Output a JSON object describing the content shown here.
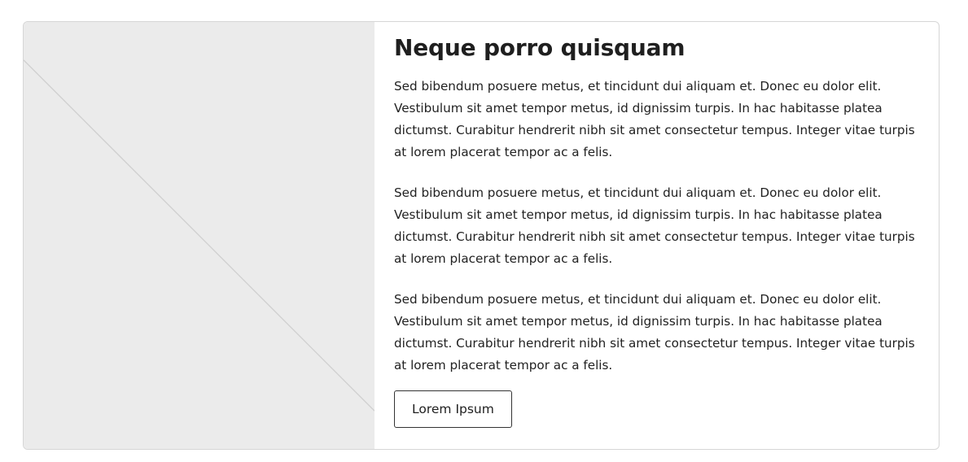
{
  "card": {
    "title": "Neque porro quisquam",
    "paragraphs": [
      "Sed bibendum posuere metus, et tincidunt dui aliquam et. Donec eu dolor elit. Vestibulum sit amet tempor metus, id dignissim turpis. In hac habitasse platea dictumst. Curabitur hendrerit nibh sit amet consectetur tempus. Integer vitae turpis at lorem placerat tempor ac a felis.",
      "Sed bibendum posuere metus, et tincidunt dui aliquam et. Donec eu dolor elit. Vestibulum sit amet tempor metus, id dignissim turpis. In hac habitasse platea dictumst. Curabitur hendrerit nibh sit amet consectetur tempus. Integer vitae turpis at lorem placerat tempor ac a felis.",
      "Sed bibendum posuere metus, et tincidunt dui aliquam et. Donec eu dolor elit. Vestibulum sit amet tempor metus, id dignissim turpis. In hac habitasse platea dictumst. Curabitur hendrerit nibh sit amet consectetur tempus. Integer vitae turpis at lorem placerat tempor ac a felis."
    ],
    "button_label": "Lorem Ipsum",
    "image_placeholder_color": "#ebebeb",
    "border_color": "#d6d6d6"
  }
}
